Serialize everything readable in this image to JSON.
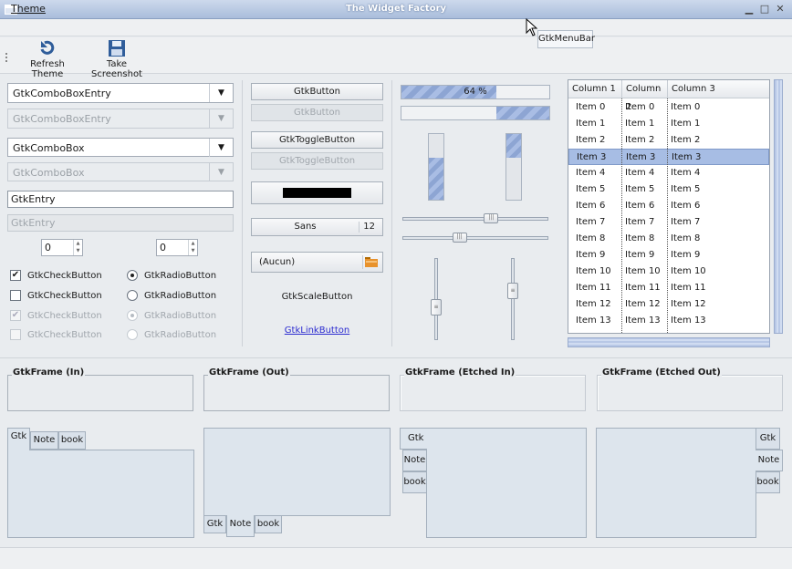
{
  "window": {
    "title": "The Widget Factory"
  },
  "menubar": {
    "theme": "Theme"
  },
  "tooltip": "GtkMenuBar",
  "toolbar": {
    "refresh": "Refresh Theme",
    "screenshot": "Take Screenshot"
  },
  "col1": {
    "combo_entry": "GtkComboBoxEntry",
    "combo_entry_dis": "GtkComboBoxEntry",
    "combo": "GtkComboBox",
    "combo_dis": "GtkComboBox",
    "entry": "GtkEntry",
    "entry_dis": "GtkEntry",
    "spin1": "0",
    "spin2": "0",
    "check1": "GtkCheckButton",
    "check2": "GtkCheckButton",
    "check3": "GtkCheckButton",
    "check4": "GtkCheckButton",
    "radio1": "GtkRadioButton",
    "radio2": "GtkRadioButton",
    "radio3": "GtkRadioButton",
    "radio4": "GtkRadioButton"
  },
  "col2": {
    "button": "GtkButton",
    "button_dis": "GtkButton",
    "toggle": "GtkToggleButton",
    "toggle_dis": "GtkToggleButton",
    "color": "#000000",
    "font_name": "Sans",
    "font_size": "12",
    "file": "(Aucun)",
    "scale_button": "GtkScaleButton",
    "link_button": "GtkLinkButton"
  },
  "col3": {
    "progress_text": "64 %",
    "progress": 0.64,
    "progress2": 0.36,
    "vprogress1": 0.64,
    "vprogress2": 0.36,
    "hscale1": 0.62,
    "hscale2": 0.38,
    "vscale1": 0.62,
    "vscale2": 0.38
  },
  "tree": {
    "headers": [
      "Column 1",
      "Column 2",
      "Column 3"
    ],
    "selected": 3,
    "rows": [
      [
        "Item 0",
        "Item 0",
        "Item 0"
      ],
      [
        "Item 1",
        "Item 1",
        "Item 1"
      ],
      [
        "Item 2",
        "Item 2",
        "Item 2"
      ],
      [
        "Item 3",
        "Item 3",
        "Item 3"
      ],
      [
        "Item 4",
        "Item 4",
        "Item 4"
      ],
      [
        "Item 5",
        "Item 5",
        "Item 5"
      ],
      [
        "Item 6",
        "Item 6",
        "Item 6"
      ],
      [
        "Item 7",
        "Item 7",
        "Item 7"
      ],
      [
        "Item 8",
        "Item 8",
        "Item 8"
      ],
      [
        "Item 9",
        "Item 9",
        "Item 9"
      ],
      [
        "Item 10",
        "Item 10",
        "Item 10"
      ],
      [
        "Item 11",
        "Item 11",
        "Item 11"
      ],
      [
        "Item 12",
        "Item 12",
        "Item 12"
      ],
      [
        "Item 13",
        "Item 13",
        "Item 13"
      ]
    ]
  },
  "frames": [
    "GtkFrame (In)",
    "GtkFrame (Out)",
    "GtkFrame (Etched In)",
    "GtkFrame (Etched Out)"
  ],
  "notebook_tabs": [
    "Gtk",
    "Note",
    "book"
  ],
  "colors": {
    "accent": "#a7bde4",
    "titlebar": "#a9bddb",
    "selection": "#7f99c8"
  }
}
